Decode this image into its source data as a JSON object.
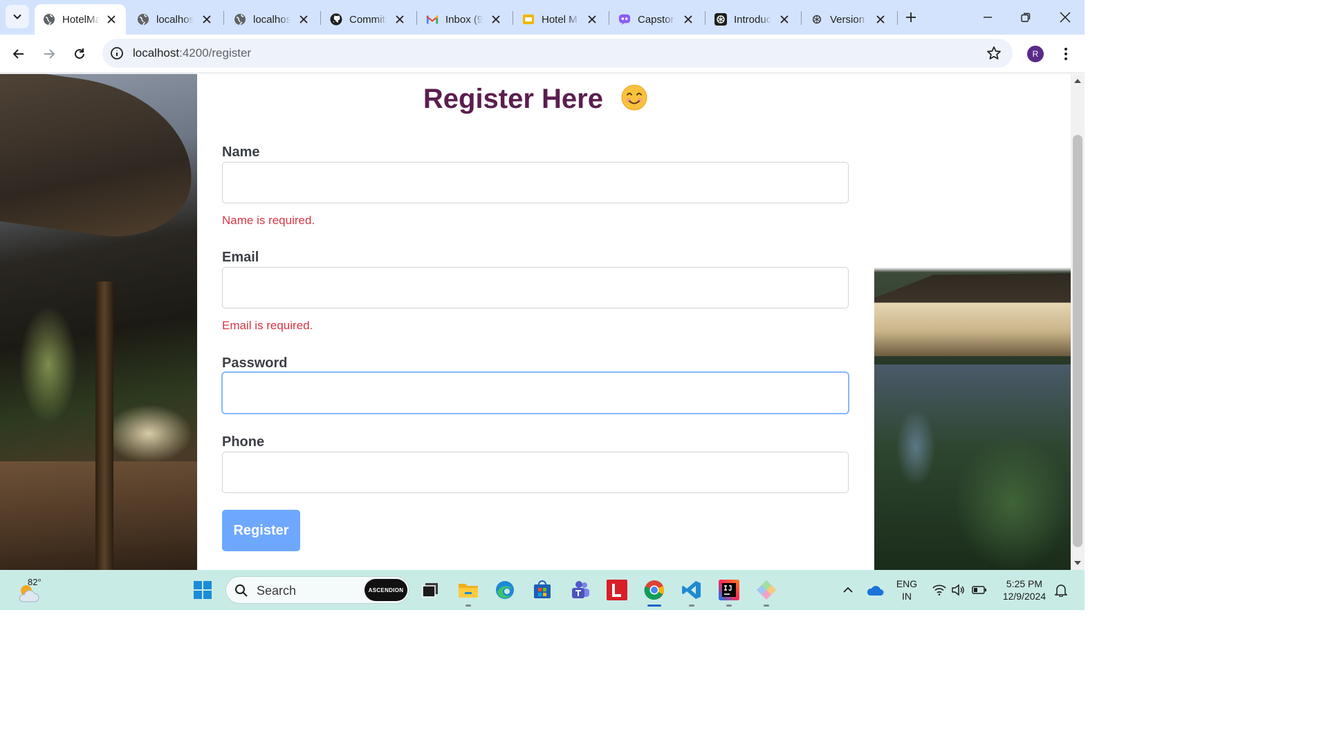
{
  "browser": {
    "tabs": [
      {
        "title": "HotelManagement",
        "icon": "globe-icon",
        "active": true
      },
      {
        "title": "localhost",
        "icon": "globe-icon"
      },
      {
        "title": "localhost",
        "icon": "globe-icon"
      },
      {
        "title": "Commits",
        "icon": "github-icon"
      },
      {
        "title": "Inbox (9",
        "icon": "gmail-icon"
      },
      {
        "title": "Hotel M",
        "icon": "slides-icon"
      },
      {
        "title": "Capstone",
        "icon": "copilot-icon"
      },
      {
        "title": "Introduc",
        "icon": "openai-icon"
      },
      {
        "title": "Version",
        "icon": "openai-icon"
      }
    ],
    "url_host": "localhost",
    "url_path": ":4200/register",
    "profile_initial": "R"
  },
  "page": {
    "title": "Register Here",
    "fields": {
      "name": {
        "label": "Name",
        "value": "",
        "error": "Name is required."
      },
      "email": {
        "label": "Email",
        "value": "",
        "error": "Email is required."
      },
      "password": {
        "label": "Password",
        "value": ""
      },
      "phone": {
        "label": "Phone",
        "value": ""
      }
    },
    "submit_label": "Register"
  },
  "taskbar": {
    "weather_temp": "82°",
    "search_placeholder": "Search",
    "search_badge": "ASCENDION",
    "language_line1": "ENG",
    "language_line2": "IN",
    "time": "5:25 PM",
    "date": "12/9/2024"
  },
  "colors": {
    "title": "#5b1e4f",
    "error": "#dc3545",
    "button": "#6ea8fe",
    "tabstrip": "#d3e3fd",
    "taskbar": "#c9ebe6"
  }
}
